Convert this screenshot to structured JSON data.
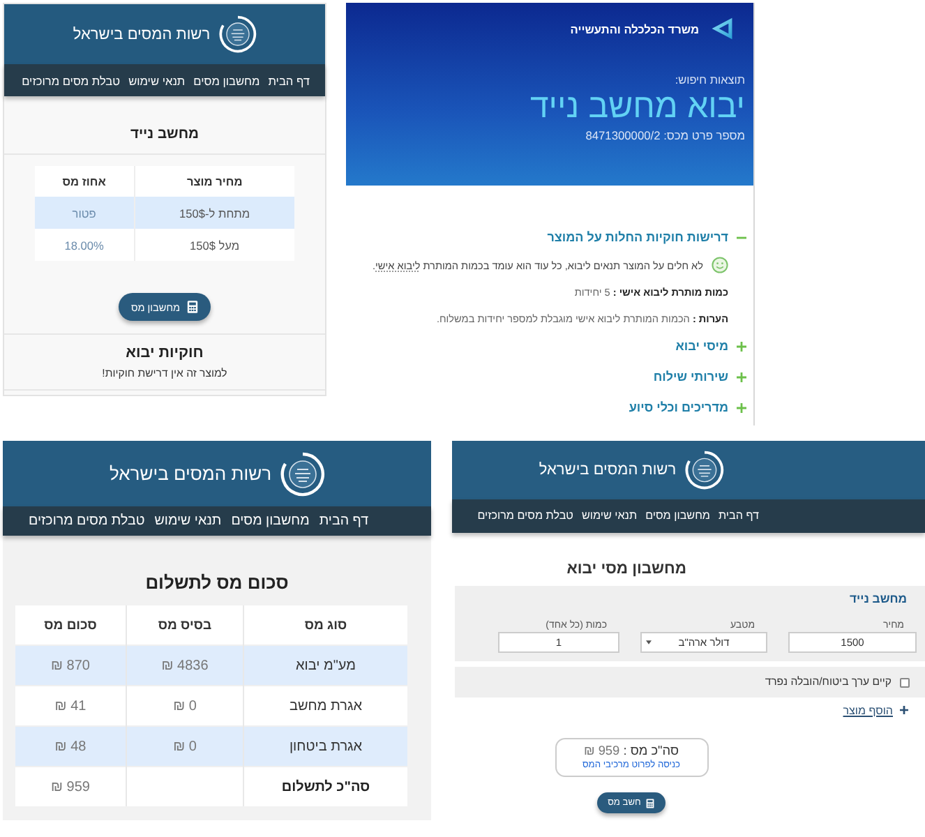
{
  "product_page": {
    "header": {
      "title": "רשות המסים בישראל"
    },
    "nav": [
      "דף הבית",
      "מחשבון מסים",
      "תנאי שימוש",
      "טבלת מסים מרוכזים"
    ],
    "title": "מחשב נייד",
    "table": {
      "columns": [
        "מחיר מוצר",
        "אחוז מס"
      ],
      "rows": [
        [
          "מתחת ל-150$",
          "פטור"
        ],
        [
          "מעל 150$",
          "18.00%"
        ]
      ]
    },
    "calculator_button": "מחשבון מס",
    "legality": {
      "title": "חוקיות יבוא",
      "text": "למוצר זה אין דרישת חוקיות!"
    }
  },
  "ministry_page": {
    "ministry": "משרד הכלכלה והתעשייה",
    "search_label": "תוצאות חיפוש:",
    "headline": "יבוא מחשב נייד",
    "tariff_item": "מספר פרט מכס: 8471300000/2",
    "sections": [
      {
        "title": "דרישות חוקיות החלות על המוצר",
        "expanded": true,
        "notice": {
          "text": "לא חלים על המוצר תנאים ליבוא, כל עוד הוא עומד בכמות המותרת",
          "link": "ליבוא אישי",
          "end": "."
        },
        "details": [
          "**כמות מותרת ליבוא אישי :** 5 יחידות",
          "**הערות :** הכמות המותרת ליבוא אישי מוגבלת למספר יחידות במשלוח."
        ]
      },
      {
        "title": "מיסי יבוא",
        "expanded": false
      },
      {
        "title": "שירותי שילוח",
        "expanded": false
      },
      {
        "title": "מדריכים וכלי סיוע",
        "expanded": false
      }
    ]
  },
  "tax_summary_page": {
    "header": {
      "title": "רשות המסים בישראל"
    },
    "nav": [
      "דף הבית",
      "מחשבון מסים",
      "תנאי שימוש",
      "טבלת מסים מרוכזים"
    ],
    "title": "סכום מס לתשלום",
    "table": {
      "columns": [
        "סוג מס",
        "בסיס מס",
        "סכום מס"
      ],
      "rows": [
        {
          "kind": "tax",
          "type": "מע\"מ יבוא",
          "base": "4836 ₪",
          "amount": "870 ₪"
        },
        {
          "kind": "tax",
          "type": "אגרת מחשב",
          "base": "0 ₪",
          "amount": "41 ₪"
        },
        {
          "kind": "tax",
          "type": "אגרת ביטחון",
          "base": "0 ₪",
          "amount": "48 ₪"
        },
        {
          "kind": "total",
          "type": "סה\"כ לתשלום",
          "amount": "959 ₪"
        }
      ]
    }
  },
  "calculator_page": {
    "header": {
      "title": "רשות המסים בישראל"
    },
    "nav": [
      "דף הבית",
      "מחשבון מסים",
      "תנאי שימוש",
      "טבלת מסים מרוכזים"
    ],
    "title": "מחשבון מסי יבוא",
    "product": {
      "name": "מחשב נייד",
      "fields": [
        {
          "kind": "input",
          "label": "מחיר",
          "value": "1500"
        },
        {
          "kind": "select",
          "label": "מטבע",
          "value": "דולר ארה\"ב"
        },
        {
          "kind": "input",
          "label": "כמות (כל אחד)",
          "value": "1"
        }
      ]
    },
    "insurance_checkbox": {
      "label": "קיים ערך ביטוח/הובלה נפרד",
      "checked": false
    },
    "add_product_link": "הוסף מוצר",
    "result": {
      "label": "סה\"כ מס :",
      "value": "959 ₪",
      "link": "כניסה לפרוט מרכיבי המס"
    },
    "calculate_button": "חשב מס"
  }
}
